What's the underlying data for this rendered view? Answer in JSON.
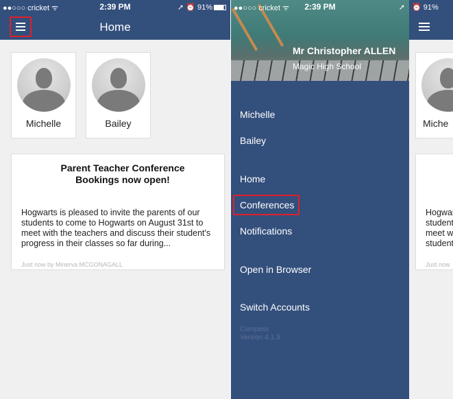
{
  "left_screen": {
    "status": {
      "carrier": "●●○○○ cricket ᯤ",
      "time": "2:39 PM",
      "right": "➚ ⏰ 91%"
    },
    "title": "Home",
    "children": [
      {
        "name": "Michelle"
      },
      {
        "name": "Bailey"
      }
    ],
    "news": {
      "title": "Parent Teacher Conference Bookings now open!",
      "body": "Hogwarts is pleased to invite the parents of our students to come to Hogwarts on August 31st to meet with the teachers and discuss their student's progress in their classes so far during...",
      "meta": "Just now by Minerva MCGONAGALL"
    }
  },
  "drawer": {
    "status": {
      "carrier": "●●○○○ cricket ᯤ",
      "time": "2:39 PM",
      "right": "➚"
    },
    "teacher_name": "Mr Christopher ALLEN",
    "school": "Magic High School",
    "items": {
      "michelle": "Michelle",
      "bailey": "Bailey",
      "home": "Home",
      "conferences": "Conferences",
      "notifications": "Notifications",
      "open_browser": "Open in Browser",
      "switch_accounts": "Switch Accounts"
    },
    "version_app": "Compass",
    "version": "Version 4.1.3"
  },
  "right_screen": {
    "status": {
      "right": "⏰ 91%"
    },
    "child_name": "Miche",
    "news_lines": [
      "Hogwar",
      "student",
      "meet w",
      "student"
    ],
    "meta": "Just now"
  },
  "colors": {
    "navbar": "#334f7c",
    "highlight": "#e0202b"
  }
}
